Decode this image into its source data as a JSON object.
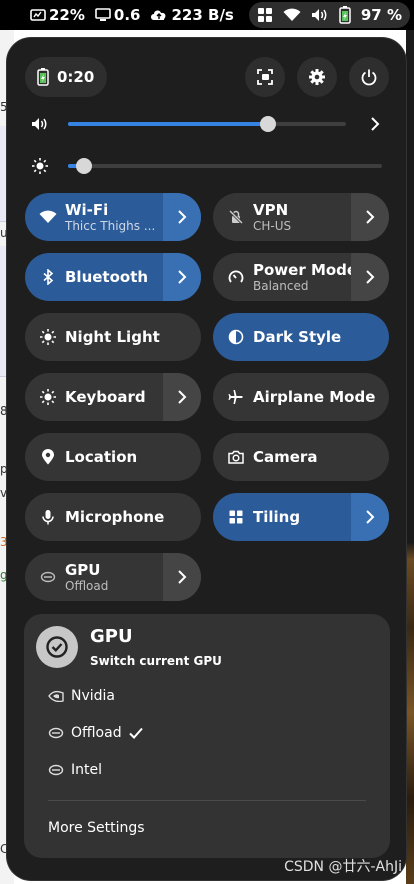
{
  "status_bar": {
    "cpu_usage": "22%",
    "load": "0.6",
    "network_speed": "223 B/s",
    "battery_percent": "97 %"
  },
  "background": {
    "fragments": [
      "5",
      "ut",
      "8",
      "p",
      "vi",
      "3",
      "gi",
      "C"
    ]
  },
  "panel": {
    "battery_time": "0:20",
    "volume_level": 0.72,
    "brightness_level": 0.05,
    "tiles": [
      {
        "id": "wifi",
        "title": "Wi-Fi",
        "subtitle": "Thicc Thighs ...",
        "active": true,
        "has_menu": true,
        "icon": "wifi-icon"
      },
      {
        "id": "vpn",
        "title": "VPN",
        "subtitle": "CH-US",
        "active": false,
        "has_menu": true,
        "icon": "vpn-off-icon"
      },
      {
        "id": "bluetooth",
        "title": "Bluetooth",
        "subtitle": "",
        "active": true,
        "has_menu": true,
        "icon": "bluetooth-icon"
      },
      {
        "id": "power-mode",
        "title": "Power Mode",
        "subtitle": "Balanced",
        "active": false,
        "has_menu": true,
        "icon": "power-mode-icon"
      },
      {
        "id": "night-light",
        "title": "Night Light",
        "subtitle": "",
        "active": false,
        "has_menu": false,
        "icon": "night-light-icon"
      },
      {
        "id": "dark-style",
        "title": "Dark Style",
        "subtitle": "",
        "active": true,
        "has_menu": false,
        "icon": "dark-style-icon"
      },
      {
        "id": "keyboard",
        "title": "Keyboard",
        "subtitle": "",
        "active": false,
        "has_menu": true,
        "icon": "keyboard-brightness-icon"
      },
      {
        "id": "airplane",
        "title": "Airplane Mode",
        "subtitle": "",
        "active": false,
        "has_menu": false,
        "icon": "airplane-icon"
      },
      {
        "id": "location",
        "title": "Location",
        "subtitle": "",
        "active": false,
        "has_menu": false,
        "icon": "location-icon"
      },
      {
        "id": "camera",
        "title": "Camera",
        "subtitle": "",
        "active": false,
        "has_menu": false,
        "icon": "camera-icon"
      },
      {
        "id": "microphone",
        "title": "Microphone",
        "subtitle": "",
        "active": false,
        "has_menu": false,
        "icon": "microphone-icon"
      },
      {
        "id": "tiling",
        "title": "Tiling",
        "subtitle": "",
        "active": true,
        "has_menu": true,
        "icon": "tiling-icon"
      },
      {
        "id": "gpu",
        "title": "GPU",
        "subtitle": "Offload",
        "active": false,
        "has_menu": true,
        "icon": "gpu-icon"
      }
    ]
  },
  "gpu_menu": {
    "title": "GPU",
    "subtitle": "Switch current GPU",
    "options": [
      {
        "label": "Nvidia",
        "checked": false,
        "icon": "nvidia-icon"
      },
      {
        "label": "Offload",
        "checked": true,
        "icon": "gpu-chip-icon"
      },
      {
        "label": "Intel",
        "checked": false,
        "icon": "gpu-chip-icon"
      }
    ],
    "more_settings": "More Settings"
  },
  "watermark": "CSDN @廿六-AhJi",
  "colors": {
    "accent": "#2b5b98",
    "accent_arrow": "#3970b3",
    "panel_bg": "#1e1e1e",
    "tile_bg": "#353535",
    "slider_fill": "#3584e4"
  }
}
